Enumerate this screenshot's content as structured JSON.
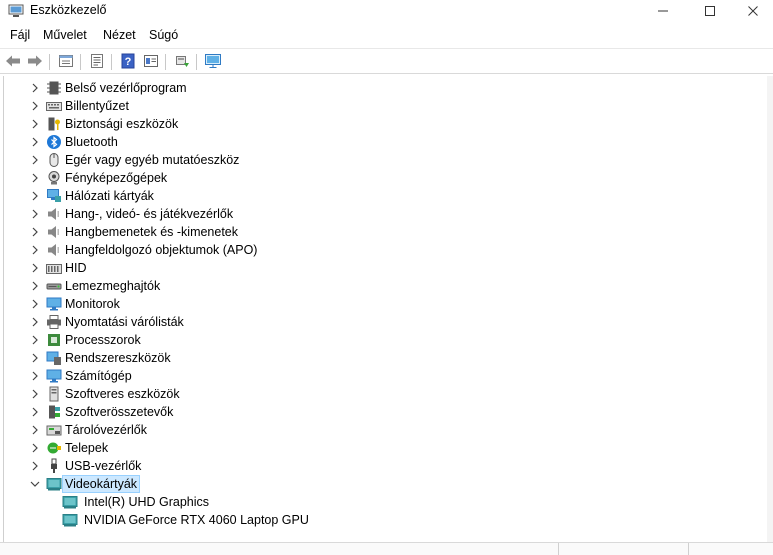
{
  "window": {
    "title": "Eszközkezelő",
    "controls": {
      "minimize": "─",
      "maximize": "☐",
      "close": "✕"
    }
  },
  "menu": {
    "items": [
      {
        "label": "Fájl"
      },
      {
        "label": "Művelet"
      },
      {
        "label": "Nézet"
      },
      {
        "label": "Súgó"
      }
    ]
  },
  "toolbar": {
    "buttons": [
      "back-arrow-icon",
      "forward-arrow-icon",
      "properties-icon",
      "details-view-icon",
      "help-icon",
      "sheet-icon",
      "scan-hardware-icon",
      "monitor-display-icon"
    ]
  },
  "tree": {
    "categories": [
      {
        "label": "Belső vezérlőprogram",
        "icon": "firmware-chip-icon"
      },
      {
        "label": "Billentyűzet",
        "icon": "keyboard-icon"
      },
      {
        "label": "Biztonsági eszközök",
        "icon": "security-key-icon"
      },
      {
        "label": "Bluetooth",
        "icon": "bluetooth-icon"
      },
      {
        "label": "Egér vagy egyéb mutatóeszköz",
        "icon": "mouse-icon"
      },
      {
        "label": "Fényképezőgépek",
        "icon": "camera-icon"
      },
      {
        "label": "Hálózati kártyák",
        "icon": "network-adapter-icon"
      },
      {
        "label": "Hang-, videó- és játékvezérlők",
        "icon": "speaker-icon"
      },
      {
        "label": "Hangbemenetek és -kimenetek",
        "icon": "speaker-icon"
      },
      {
        "label": "Hangfeldolgozó objektumok (APO)",
        "icon": "speaker-icon"
      },
      {
        "label": "HID",
        "icon": "hid-icon"
      },
      {
        "label": "Lemezmeghajtók",
        "icon": "disk-drive-icon"
      },
      {
        "label": "Monitorok",
        "icon": "monitor-icon"
      },
      {
        "label": "Nyomtatási várólisták",
        "icon": "printer-icon"
      },
      {
        "label": "Processzorok",
        "icon": "processor-icon"
      },
      {
        "label": "Rendszereszközök",
        "icon": "system-devices-icon"
      },
      {
        "label": "Számítógép",
        "icon": "computer-icon"
      },
      {
        "label": "Szoftveres eszközök",
        "icon": "software-device-icon"
      },
      {
        "label": "Szoftverösszetevők",
        "icon": "software-component-icon"
      },
      {
        "label": "Tárolóvezérlők",
        "icon": "storage-controller-icon"
      },
      {
        "label": "Telepek",
        "icon": "battery-icon"
      },
      {
        "label": "USB-vezérlők",
        "icon": "usb-icon"
      },
      {
        "label": "Videokártyák",
        "icon": "display-adapter-icon",
        "expanded": true,
        "selected": true
      }
    ],
    "children": [
      {
        "label": "Intel(R) UHD Graphics",
        "icon": "display-adapter-icon"
      },
      {
        "label": "NVIDIA GeForce RTX 4060 Laptop GPU",
        "icon": "display-adapter-icon"
      }
    ]
  },
  "colors": {
    "selection_bg": "#cce8ff",
    "selection_border": "#99d1ff",
    "chevron": "#444444",
    "icon_blue": "#2f7ac4",
    "icon_teal": "#3aa0a8"
  }
}
